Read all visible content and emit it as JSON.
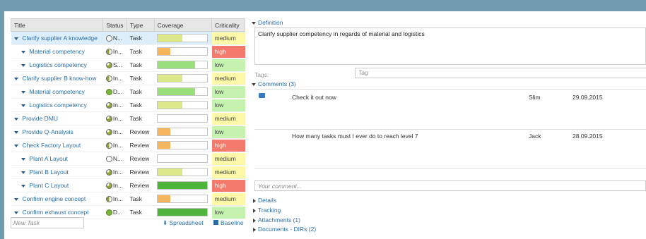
{
  "table": {
    "headers": [
      "Title",
      "Status",
      "Type",
      "Coverage",
      "Criticality"
    ],
    "rows": [
      {
        "title": "Clarify supplier A knowledge",
        "status": "N...",
        "status_icon": "none",
        "type": "Task",
        "coverage": 0.5,
        "bar_color": "#dbe98a",
        "criticality": "medium"
      },
      {
        "title": "Material competency",
        "status": "In...",
        "status_icon": "half",
        "type": "Task",
        "coverage": 0.25,
        "bar_color": "#f6b55c",
        "criticality": "high"
      },
      {
        "title": "Logistics competency",
        "status": "S...",
        "status_icon": "most",
        "type": "Task",
        "coverage": 0.75,
        "bar_color": "#99e07a",
        "criticality": "low"
      },
      {
        "title": "Clarify supplier B know-how",
        "status": "In...",
        "status_icon": "half",
        "type": "Task",
        "coverage": 0.5,
        "bar_color": "#dbe98a",
        "criticality": "medium"
      },
      {
        "title": "Material competency",
        "status": "D...",
        "status_icon": "done",
        "type": "Task",
        "coverage": 0.75,
        "bar_color": "#99e07a",
        "criticality": "low"
      },
      {
        "title": "Logistics competency",
        "status": "In...",
        "status_icon": "most",
        "type": "Task",
        "coverage": 0.5,
        "bar_color": "#dbe98a",
        "criticality": "low"
      },
      {
        "title": "Provide DMU",
        "status": "In...",
        "status_icon": "most",
        "type": "Task",
        "coverage": 0,
        "bar_color": "#dbe98a",
        "criticality": "medium"
      },
      {
        "title": "Provide Q-Analysis",
        "status": "In...",
        "status_icon": "most",
        "type": "Review",
        "coverage": 0.25,
        "bar_color": "#f6b55c",
        "criticality": "low"
      },
      {
        "title": "Check Factory Layout",
        "status": "In...",
        "status_icon": "half",
        "type": "Review",
        "coverage": 0.25,
        "bar_color": "#f6b55c",
        "criticality": "high"
      },
      {
        "title": "Plant A Layout",
        "status": "N...",
        "status_icon": "none",
        "type": "Review",
        "coverage": 0,
        "bar_color": "#dbe98a",
        "criticality": "medium"
      },
      {
        "title": "Plant B Layout",
        "status": "In...",
        "status_icon": "most",
        "type": "Review",
        "coverage": 0.5,
        "bar_color": "#dbe98a",
        "criticality": "medium"
      },
      {
        "title": "Plant C Layout",
        "status": "In...",
        "status_icon": "most",
        "type": "Review",
        "coverage": 1,
        "bar_color": "#4fb53a",
        "criticality": "high"
      },
      {
        "title": "Confirm engine concept",
        "status": "In...",
        "status_icon": "half",
        "type": "Task",
        "coverage": 0.25,
        "bar_color": "#f6b55c",
        "criticality": "medium"
      },
      {
        "title": "Confirm exhaust concept",
        "status": "D...",
        "status_icon": "done",
        "type": "Task",
        "coverage": 1,
        "bar_color": "#4fb53a",
        "criticality": "low"
      }
    ],
    "indent": [
      0,
      1,
      1,
      0,
      1,
      1,
      0,
      0,
      0,
      1,
      1,
      1,
      0,
      0
    ]
  },
  "new_task_placeholder": "New Task",
  "spreadsheet_label": "Spreadsheet",
  "baseline_label": "Baseline",
  "definition_label": "Definition",
  "definition_text": "Clarify supplier competency in regards of material and logistics",
  "tags_label": "Tags:",
  "tag_placeholder": "Tag",
  "comments_label": "Comments (3)",
  "comments": [
    {
      "text": "Check it out now",
      "author": "Slim",
      "date": "29.09.2015"
    },
    {
      "text": "How many tasks must I ever do to reach level 7",
      "author": "Jack",
      "date": "28.09.2015"
    }
  ],
  "comment_placeholder": "Your comment...",
  "sections": [
    "Details",
    "Tracking",
    "Attachments (1)",
    "Documents - DIRs (2)"
  ],
  "colors": {
    "medium": "#fdf9a8",
    "high": "#f47a6d",
    "low": "#c6f2b0",
    "link": "#2a6ea8"
  }
}
